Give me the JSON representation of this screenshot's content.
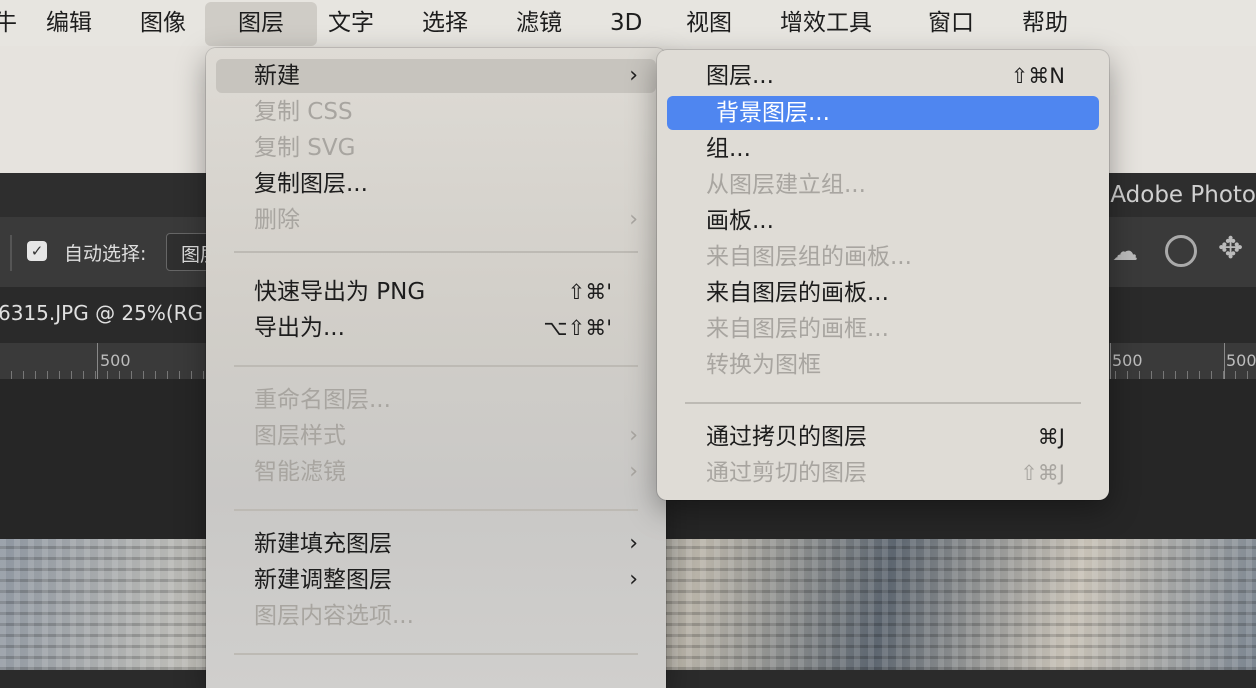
{
  "menubar": {
    "items": [
      "编辑",
      "图像",
      "图层",
      "文字",
      "选择",
      "滤镜",
      "3D",
      "视图",
      "增效工具",
      "窗口",
      "帮助"
    ],
    "partial_left": "牛",
    "active": "图层"
  },
  "photoshop": {
    "app_title": "Adobe Photo",
    "auto_select_label": "自动选择:",
    "auto_select_value": "图层",
    "doc_tab": "6315.JPG @ 25%(RG",
    "ruler_labels": [
      "500",
      "500",
      "500"
    ]
  },
  "layer_menu": {
    "items": [
      {
        "label": "新建",
        "arrow": "›",
        "state": "hover"
      },
      {
        "label": "复制 CSS",
        "state": "disabled"
      },
      {
        "label": "复制 SVG",
        "state": "disabled"
      },
      {
        "label": "复制图层...",
        "state": "normal"
      },
      {
        "label": "删除",
        "arrow": "›",
        "state": "disabled"
      },
      {
        "label": "快速导出为 PNG",
        "shortcut": "⇧⌘'",
        "state": "normal"
      },
      {
        "label": "导出为...",
        "shortcut": "⌥⇧⌘'",
        "state": "normal"
      },
      {
        "label": "重命名图层...",
        "state": "disabled"
      },
      {
        "label": "图层样式",
        "arrow": "›",
        "state": "disabled"
      },
      {
        "label": "智能滤镜",
        "arrow": "›",
        "state": "disabled"
      },
      {
        "label": "新建填充图层",
        "arrow": "›",
        "state": "normal"
      },
      {
        "label": "新建调整图层",
        "arrow": "›",
        "state": "normal"
      },
      {
        "label": "图层内容选项...",
        "state": "disabled"
      }
    ]
  },
  "new_submenu": {
    "items": [
      {
        "label": "图层...",
        "shortcut": "⇧⌘N",
        "state": "normal"
      },
      {
        "label": "背景图层...",
        "state": "selected"
      },
      {
        "label": "组...",
        "state": "normal"
      },
      {
        "label": "从图层建立组...",
        "state": "disabled"
      },
      {
        "label": "画板...",
        "state": "normal"
      },
      {
        "label": "来自图层组的画板...",
        "state": "disabled"
      },
      {
        "label": "来自图层的画板...",
        "state": "normal"
      },
      {
        "label": "来自图层的画框...",
        "state": "disabled"
      },
      {
        "label": "转换为图框",
        "state": "disabled"
      },
      {
        "label": "通过拷贝的图层",
        "shortcut": "⌘J",
        "state": "normal"
      },
      {
        "label": "通过剪切的图层",
        "shortcut": "⇧⌘J",
        "state": "disabled"
      }
    ]
  },
  "colors": {
    "selection_blue": "#4f86f0",
    "menu_bg": "#dfdcd6",
    "disabled_text": "#a8a5a0"
  }
}
